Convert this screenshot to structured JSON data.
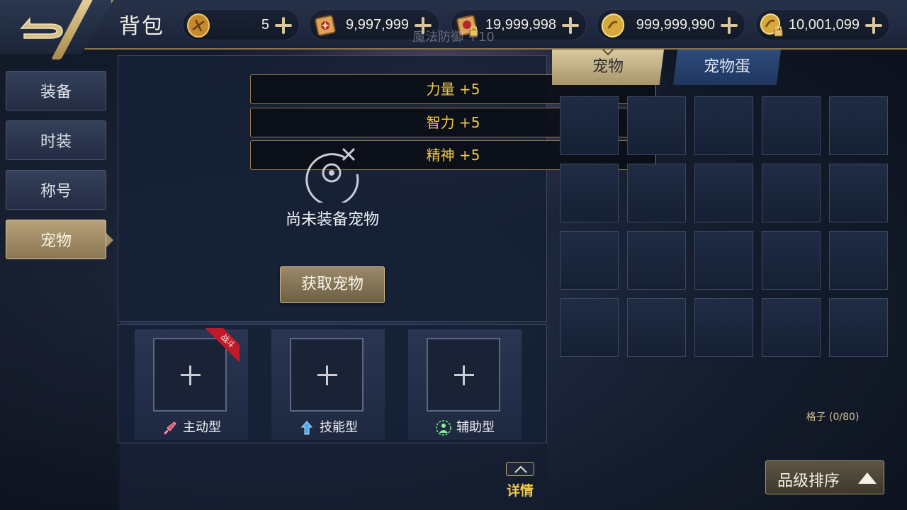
{
  "header": {
    "title": "背包"
  },
  "currencies": [
    {
      "icon": "bronze-coin-icon",
      "value": "5"
    },
    {
      "icon": "scroll-icon",
      "value": "9,997,999"
    },
    {
      "icon": "locked-scroll-icon",
      "value": "19,999,998"
    },
    {
      "icon": "gold-coin-icon",
      "value": "999,999,990"
    },
    {
      "icon": "locked-gold-coin-icon",
      "value": "10,001,099"
    }
  ],
  "sidebar": {
    "items": [
      {
        "label": "装备"
      },
      {
        "label": "时装"
      },
      {
        "label": "称号"
      },
      {
        "label": "宠物"
      }
    ],
    "active_index": 3
  },
  "center": {
    "faded_text": "魔法防御 +10",
    "stats": [
      "力量 +5",
      "智力 +5",
      "精神 +5"
    ],
    "empty_text": "尚未装备宠物",
    "get_pet_label": "获取宠物",
    "slots": [
      {
        "label": "主动型",
        "icon": "sword-icon",
        "badge": "战斗"
      },
      {
        "label": "技能型",
        "icon": "skill-arrow-icon"
      },
      {
        "label": "辅助型",
        "icon": "support-person-icon"
      }
    ],
    "details_label": "详情"
  },
  "right": {
    "tabs": [
      {
        "label": "宠物"
      },
      {
        "label": "宠物蛋"
      }
    ],
    "active_tab": 0,
    "capacity_text": "格子 (0/80)",
    "sort_label": "品级排序"
  },
  "colors": {
    "accent_gold": "#d7c49a",
    "stat_text": "#f2c94a",
    "badge_red": "#c01a2a"
  }
}
